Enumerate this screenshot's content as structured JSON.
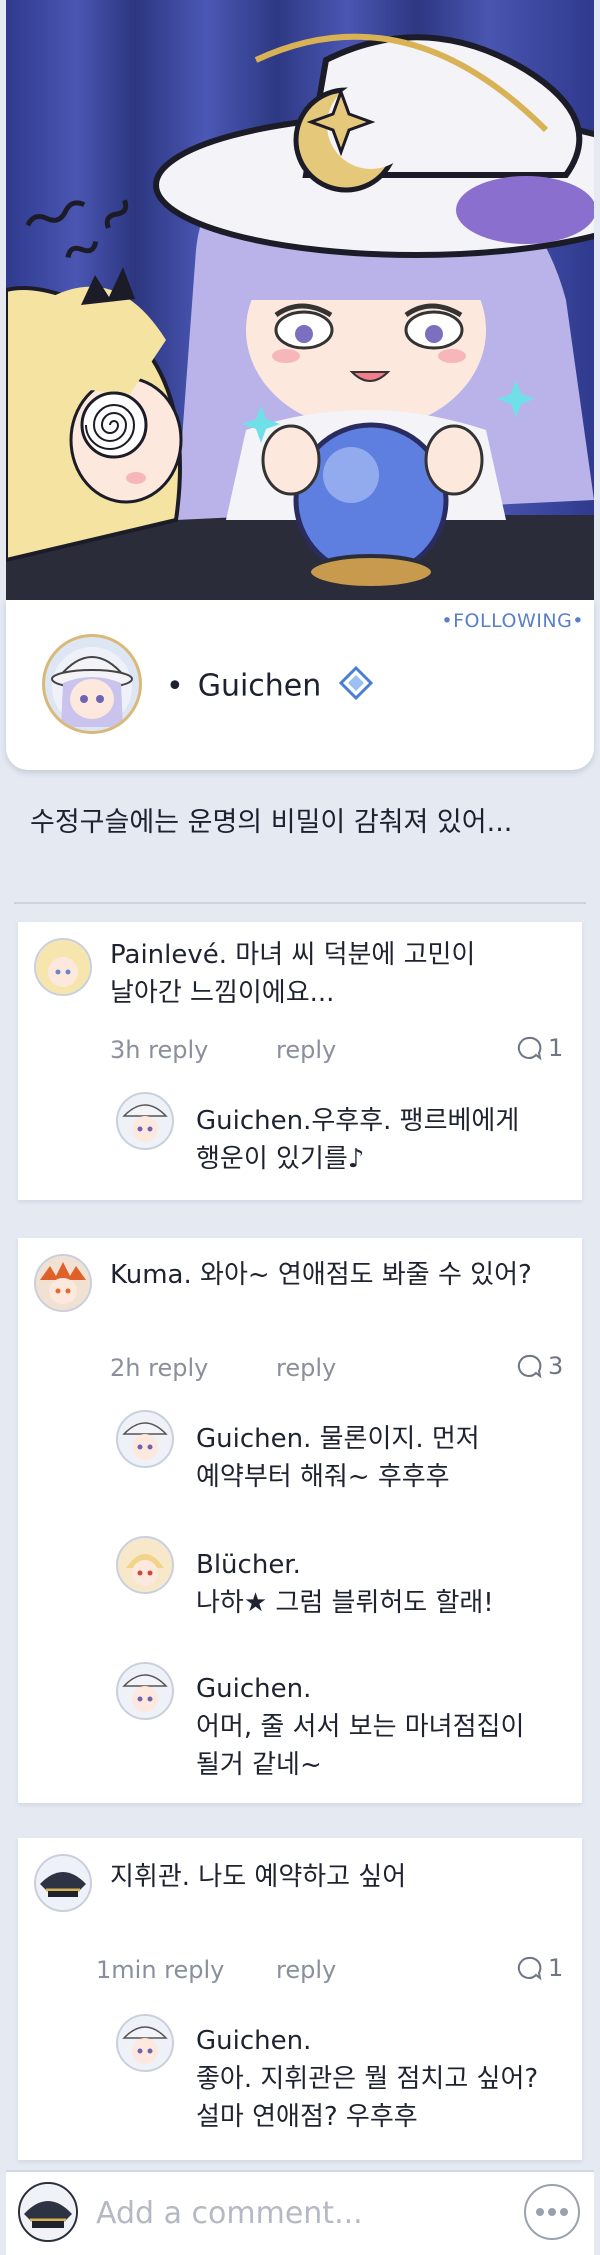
{
  "post": {
    "following_label": "•FOLLOWING•",
    "author": "Guichen",
    "text": "수정구슬에는 운명의 비밀이 감춰져 있어..."
  },
  "threads": [
    {
      "name": "Painlevé.",
      "text": "마녀 씨 덕분에 고민이\n날아간 느낌이에요...",
      "time": "3h reply",
      "reply_label": "reply",
      "count": "1",
      "replies": [
        {
          "name": "Guichen.",
          "text": "우후후. 팽르베에게\n행운이 있기를♪"
        }
      ]
    },
    {
      "name": "Kuma.",
      "text": "와아~ 연애점도 봐줄 수 있어?",
      "time": "2h reply",
      "reply_label": "reply",
      "count": "3",
      "replies": [
        {
          "name": "Guichen.",
          "text": "물론이지. 먼저\n예약부터 해줘~ 후후후"
        },
        {
          "name": "Blücher.",
          "text": "\n나하★ 그럼 블뤼허도 할래!"
        },
        {
          "name": "Guichen.",
          "text": "\n어머, 줄 서서 보는 마녀점집이\n될거 같네~"
        }
      ]
    },
    {
      "name": "지휘관.",
      "text": "나도 예약하고 싶어",
      "time": "1min reply",
      "reply_label": "reply",
      "count": "1",
      "replies": [
        {
          "name": "Guichen.",
          "text": "\n좋아. 지휘관은 뭘 점치고 싶어?\n설마 연애점? 우후후"
        }
      ]
    }
  ],
  "composer": {
    "placeholder": "Add a comment..."
  },
  "colors": {
    "accent": "#5a7fc9",
    "verified": "#4a7fd6",
    "hero_bg": "#3b4699"
  }
}
